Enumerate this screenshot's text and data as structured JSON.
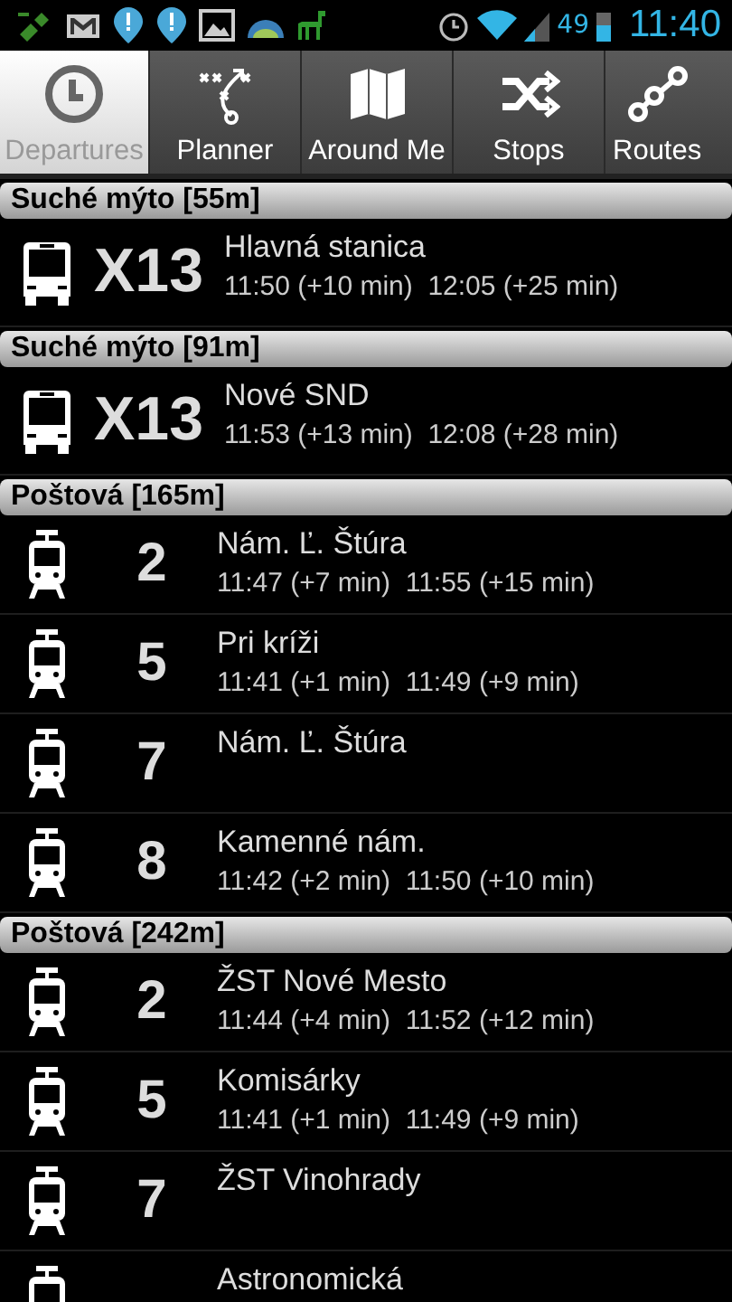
{
  "status_bar": {
    "battery": "49",
    "time": "11:40"
  },
  "tabs": [
    {
      "label": "Departures",
      "kind": "clock",
      "selected": true
    },
    {
      "label": "Planner",
      "kind": "plan",
      "selected": false
    },
    {
      "label": "Around Me",
      "kind": "map",
      "selected": false
    },
    {
      "label": "Stops",
      "kind": "shuffle",
      "selected": false
    },
    {
      "label": "Routes",
      "kind": "route",
      "selected": false
    }
  ],
  "stops": [
    {
      "name": "Suché mýto [55m]",
      "departures": [
        {
          "kind": "bus",
          "route": "X13",
          "destination": "Hlavná stanica",
          "times": "11:50 (+10 min)  12:05 (+25 min)"
        }
      ]
    },
    {
      "name": "Suché mýto [91m]",
      "departures": [
        {
          "kind": "bus",
          "route": "X13",
          "destination": "Nové SND",
          "times": "11:53 (+13 min)  12:08 (+28 min)"
        }
      ]
    },
    {
      "name": "Poštová [165m]",
      "departures": [
        {
          "kind": "tram",
          "route": "2",
          "destination": "Nám. Ľ. Štúra",
          "times": "11:47 (+7 min)  11:55 (+15 min)"
        },
        {
          "kind": "tram",
          "route": "5",
          "destination": "Pri kríži",
          "times": "11:41 (+1 min)  11:49 (+9 min)"
        },
        {
          "kind": "tram",
          "route": "7",
          "destination": "Nám. Ľ. Štúra"
        },
        {
          "kind": "tram",
          "route": "8",
          "destination": "Kamenné nám.",
          "times": "11:42 (+2 min)  11:50 (+10 min)"
        }
      ]
    },
    {
      "name": "Poštová [242m]",
      "departures": [
        {
          "kind": "tram",
          "route": "2",
          "destination": "ŽST Nové Mesto",
          "times": "11:44 (+4 min)  11:52 (+12 min)"
        },
        {
          "kind": "tram",
          "route": "5",
          "destination": "Komisárky",
          "times": "11:41 (+1 min)  11:49 (+9 min)"
        },
        {
          "kind": "tram",
          "route": "7",
          "destination": "ŽST Vinohrady"
        },
        {
          "kind": "tram",
          "destination": "Astronomická"
        }
      ]
    }
  ]
}
